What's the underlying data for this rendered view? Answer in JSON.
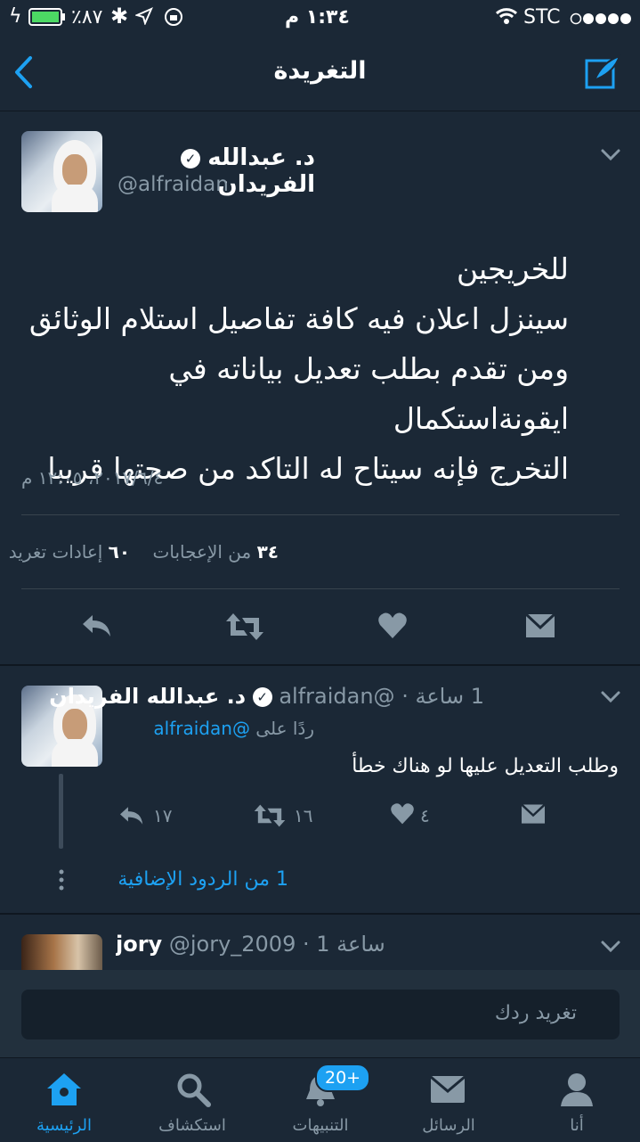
{
  "status_bar": {
    "battery": "٪٨٧",
    "time": "١:٣٤ م",
    "carrier": "STC"
  },
  "nav": {
    "title": "التغريدة"
  },
  "main_tweet": {
    "author_name": "د. عبدالله الفريدان",
    "handle": "@alfraidan",
    "text_lines": [
      "للخريجين",
      "سينزل اعلان فيه كافة تفاصيل استلام الوثائق",
      "ومن تقدم بطلب تعديل بياناته في ايقونةاستكمال",
      "التخرج فإنه سيتاح له التاكد من صحتها قريبا"
    ],
    "timestamp": "٢٠١٧/٦/٤، ١٢:٠٥ م",
    "likes_count": "٣٤",
    "likes_label": "من الإعجابات",
    "retweets_count": "٦٠",
    "retweets_label": "إعادات تغريد"
  },
  "reply_tweet": {
    "author_name": "د. عبدالله الفريدان",
    "handle": "@alfraidan",
    "time": "1 ساعة",
    "reply_to_prefix": "ردًا على",
    "reply_to_handle": "@alfraidan",
    "text": "وطلب التعديل عليها لو هناك خطأ",
    "reply_count": "١٧",
    "retweet_count": "١٦",
    "like_count": "٤",
    "more_replies": "1 من الردود الإضافية"
  },
  "third_tweet": {
    "author_name": "jory",
    "handle": "@jory_2009",
    "time": "1 ساعة"
  },
  "compose": {
    "placeholder": "تغريد ردك"
  },
  "tabs": [
    {
      "label": "الرئيسية",
      "icon": "home-icon",
      "active": true
    },
    {
      "label": "استكشاف",
      "icon": "search-icon",
      "active": false
    },
    {
      "label": "التنبيهات",
      "icon": "bell-icon",
      "active": false,
      "badge": "20+"
    },
    {
      "label": "الرسائل",
      "icon": "envelope-icon",
      "active": false
    },
    {
      "label": "أنا",
      "icon": "person-icon",
      "active": false
    }
  ],
  "colors": {
    "background": "#1b2836",
    "accent": "#1da1f2",
    "muted": "#8899a6"
  }
}
